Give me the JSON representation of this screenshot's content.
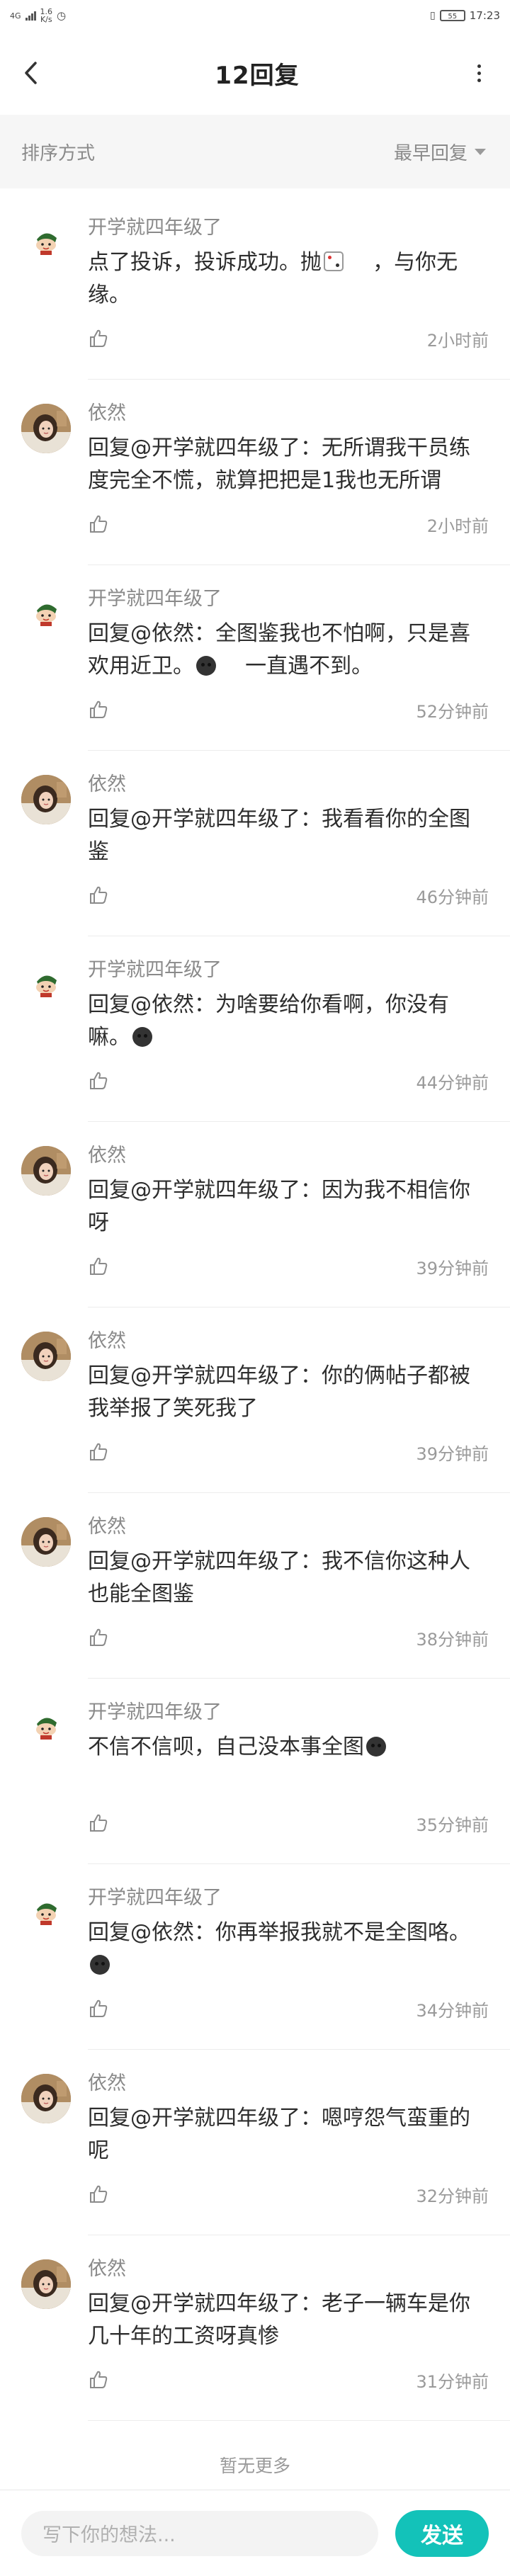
{
  "status": {
    "network": "4G",
    "speed_value": "1.6",
    "speed_unit": "K/s",
    "time": "17:23",
    "battery": "55"
  },
  "header": {
    "title": "12回复"
  },
  "sortbar": {
    "label": "排序方式",
    "current": "最早回复"
  },
  "comments": [
    {
      "author": "开学就四年级了",
      "avatar": "kid",
      "text": "点了投诉，投诉成功。抛    ，与你无缘。",
      "time": "2小时前"
    },
    {
      "author": "依然",
      "avatar": "girl",
      "text": "回复@开学就四年级了：无所谓我干员练度完全不慌，就算把把是1我也无所谓",
      "time": "2小时前"
    },
    {
      "author": "开学就四年级了",
      "avatar": "kid",
      "text": "回复@依然：全图鉴我也不怕啊，只是喜欢用近卫。    一直遇不到。",
      "time": "52分钟前"
    },
    {
      "author": "依然",
      "avatar": "girl",
      "text": "回复@开学就四年级了：我看看你的全图鉴",
      "time": "46分钟前"
    },
    {
      "author": "开学就四年级了",
      "avatar": "kid",
      "text": "回复@依然：为啥要给你看啊，你没有嘛。",
      "time": "44分钟前"
    },
    {
      "author": "依然",
      "avatar": "girl",
      "text": "回复@开学就四年级了：因为我不相信你呀",
      "time": "39分钟前"
    },
    {
      "author": "依然",
      "avatar": "girl",
      "text": "回复@开学就四年级了：你的俩帖子都被我举报了笑死我了",
      "time": "39分钟前"
    },
    {
      "author": "依然",
      "avatar": "girl",
      "text": "回复@开学就四年级了：我不信你这种人也能全图鉴",
      "time": "38分钟前"
    },
    {
      "author": "开学就四年级了",
      "avatar": "kid",
      "text": "不信不信呗，自己没本事全图",
      "time": "35分钟前"
    },
    {
      "author": "开学就四年级了",
      "avatar": "kid",
      "text": "回复@依然：你再举报我就不是全图咯。",
      "time": "34分钟前"
    },
    {
      "author": "依然",
      "avatar": "girl",
      "text": "回复@开学就四年级了：嗯哼怨气蛮重的呢",
      "time": "32分钟前"
    },
    {
      "author": "依然",
      "avatar": "girl",
      "text": "回复@开学就四年级了：老子一辆车是你几十年的工资呀真惨",
      "time": "31分钟前"
    }
  ],
  "footer": {
    "no_more": "暂无更多"
  },
  "input": {
    "placeholder": "写下你的想法...",
    "send_label": "发送"
  }
}
